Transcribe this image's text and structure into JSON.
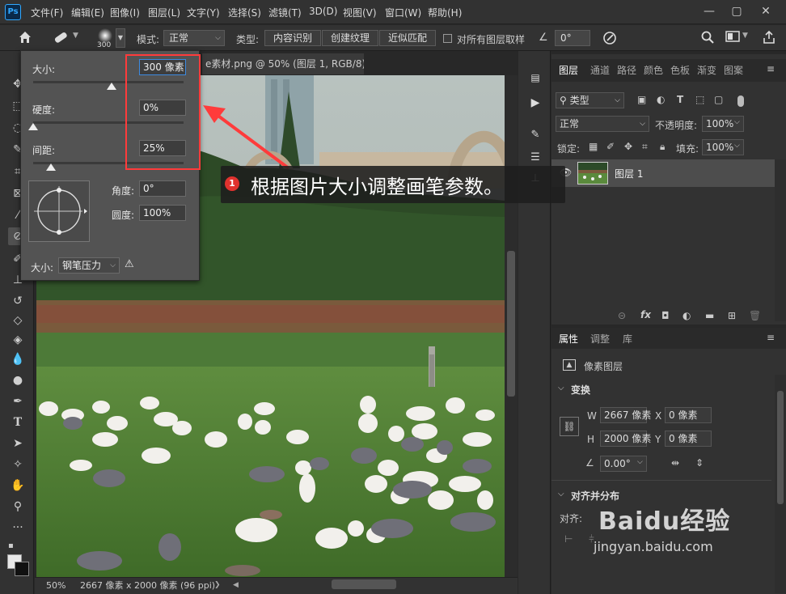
{
  "app": {
    "logo": "Ps",
    "accent": "#31a8ff"
  },
  "menu": {
    "items": [
      "文件(F)",
      "编辑(E)",
      "图像(I)",
      "图层(L)",
      "文字(Y)",
      "选择(S)",
      "滤镜(T)",
      "3D(D)",
      "视图(V)",
      "窗口(W)",
      "帮助(H)"
    ]
  },
  "window_controls": {
    "minimize": "—",
    "maximize": "▢",
    "close": "✕"
  },
  "options_bar": {
    "brush_size_value": "300",
    "mode_label": "模式:",
    "mode_value": "正常",
    "type_label": "类型:",
    "type_options": [
      "内容识别",
      "创建纹理",
      "近似匹配"
    ],
    "sample_all_label": "对所有图层取样",
    "angle_value": "0°"
  },
  "document": {
    "tab_title": "e素材.png @ 50% (图层 1, RGB/8)",
    "zoom": "50%",
    "dimensions": "2667 像素 x 2000 像素 (96 ppi)"
  },
  "brush_popup": {
    "size_label": "大小:",
    "size_value": "300 像素",
    "size_level": 0.52,
    "hardness_label": "硬度:",
    "hardness_value": "0%",
    "hardness_level": 0.0,
    "spacing_label": "间距:",
    "spacing_value": "25%",
    "spacing_level": 0.12,
    "angle_label": "角度:",
    "angle_value": "0°",
    "roundness_label": "圆度:",
    "roundness_value": "100%",
    "size_control_label": "大小:",
    "size_control_value": "钢笔压力",
    "warning_icon": "⚠"
  },
  "layers_panel": {
    "tabs": [
      "图层",
      "通道",
      "路径",
      "颜色",
      "色板",
      "渐变",
      "图案"
    ],
    "filter_kind": "类型",
    "blend_mode": "正常",
    "opacity_label": "不透明度:",
    "opacity_value": "100%",
    "lock_label": "锁定:",
    "fill_label": "填充:",
    "fill_value": "100%",
    "layer_name": "图层 1"
  },
  "properties_panel": {
    "tabs": [
      "属性",
      "调整",
      "库"
    ],
    "kind_label": "像素图层",
    "transform_title": "变换",
    "w_label": "W",
    "w_value": "2667 像素",
    "h_label": "H",
    "h_value": "2000 像素",
    "x_label": "X",
    "x_value": "0 像素",
    "y_label": "Y",
    "y_value": "0 像素",
    "rotate_value": "0.00°",
    "align_title": "对齐并分布",
    "align_label": "对齐:"
  },
  "annotation": {
    "number": "1",
    "text": "根据图片大小调整画笔参数。",
    "box_color": "#ff3b3b"
  },
  "watermark": {
    "brand": "Baidu经验",
    "url": "jingyan.baidu.com"
  }
}
